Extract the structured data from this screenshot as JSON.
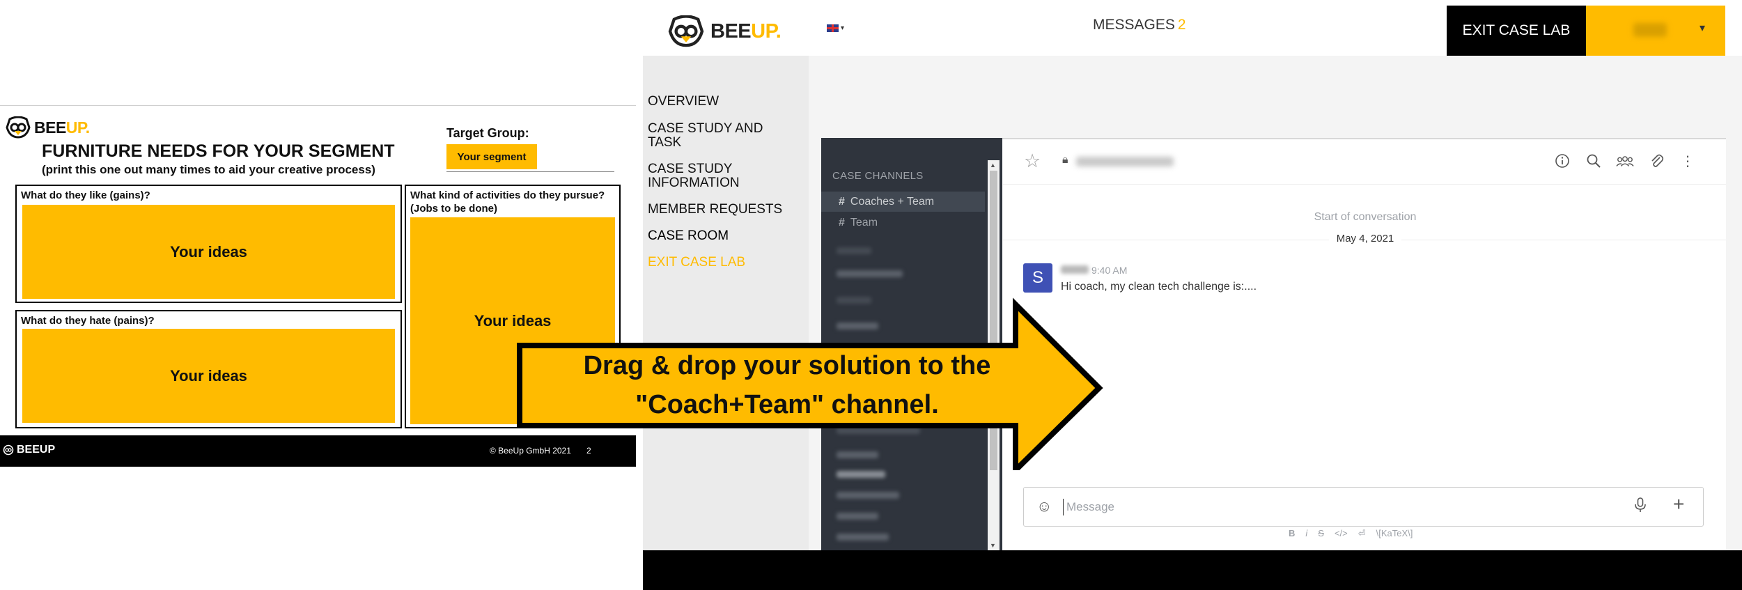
{
  "worksheet": {
    "logo_text_a": "BEE",
    "logo_text_b": "UP.",
    "title": "FURNITURE NEEDS FOR YOUR SEGMENT",
    "subtitle": "(print this one out many times to aid your creative process)",
    "target_group_label": "Target Group:",
    "segment_button": "Your segment",
    "gains_label": "What do they like (gains)?",
    "pains_label": "What do they hate (pains)?",
    "jobs_label_line1": "What kind of activities do they pursue?",
    "jobs_label_line2": "(Jobs to be done)",
    "idea_placeholder": "Your ideas",
    "footer_logo": "BEEUP",
    "footer_copyright": "© BeeUp GmbH 2021",
    "footer_page": "2"
  },
  "app": {
    "logo_text_a": "BEE",
    "logo_text_b": "UP.",
    "messages_label": "MESSAGES",
    "messages_count": "2",
    "exit_button": "EXIT CASE LAB",
    "user_caret": "▾",
    "nav": {
      "overview": "OVERVIEW",
      "case_study_task_1": "CASE STUDY AND",
      "case_study_task_2": "TASK",
      "case_study_info_1": "CASE STUDY",
      "case_study_info_2": "INFORMATION",
      "member_requests": "MEMBER REQUESTS",
      "case_room": "CASE ROOM",
      "exit_case_lab": "EXIT CASE LAB"
    },
    "chat": {
      "sidebar_header": "CASE CHANNELS",
      "channels": [
        "Coaches + Team",
        "Team"
      ],
      "conversation_start": "Start of conversation",
      "date": "May 4, 2021",
      "avatar_letter": "S",
      "message_time": "9:40 AM",
      "message_text": "Hi coach, my clean tech challenge is:....",
      "composer_placeholder": "Message",
      "formatting": [
        "B",
        "i",
        "S",
        "</>",
        "⏎",
        "\\[KaTeX\\]"
      ]
    }
  },
  "overlay": {
    "arrow_line1": "Drag & drop your solution to the",
    "arrow_line2": "\"Coach+Team\" channel."
  },
  "colors": {
    "brand_yellow": "#FFBB00",
    "black": "#000000",
    "sidebar_dark": "#2f343d",
    "avatar_blue": "#3f51b5"
  },
  "icons": [
    "bee-logo-icon",
    "flag-uk-icon",
    "star-icon",
    "lock-icon",
    "info-icon",
    "search-icon",
    "members-icon",
    "attachment-icon",
    "kebab-menu-icon",
    "emoji-icon",
    "microphone-icon",
    "plus-icon",
    "hash-icon"
  ]
}
